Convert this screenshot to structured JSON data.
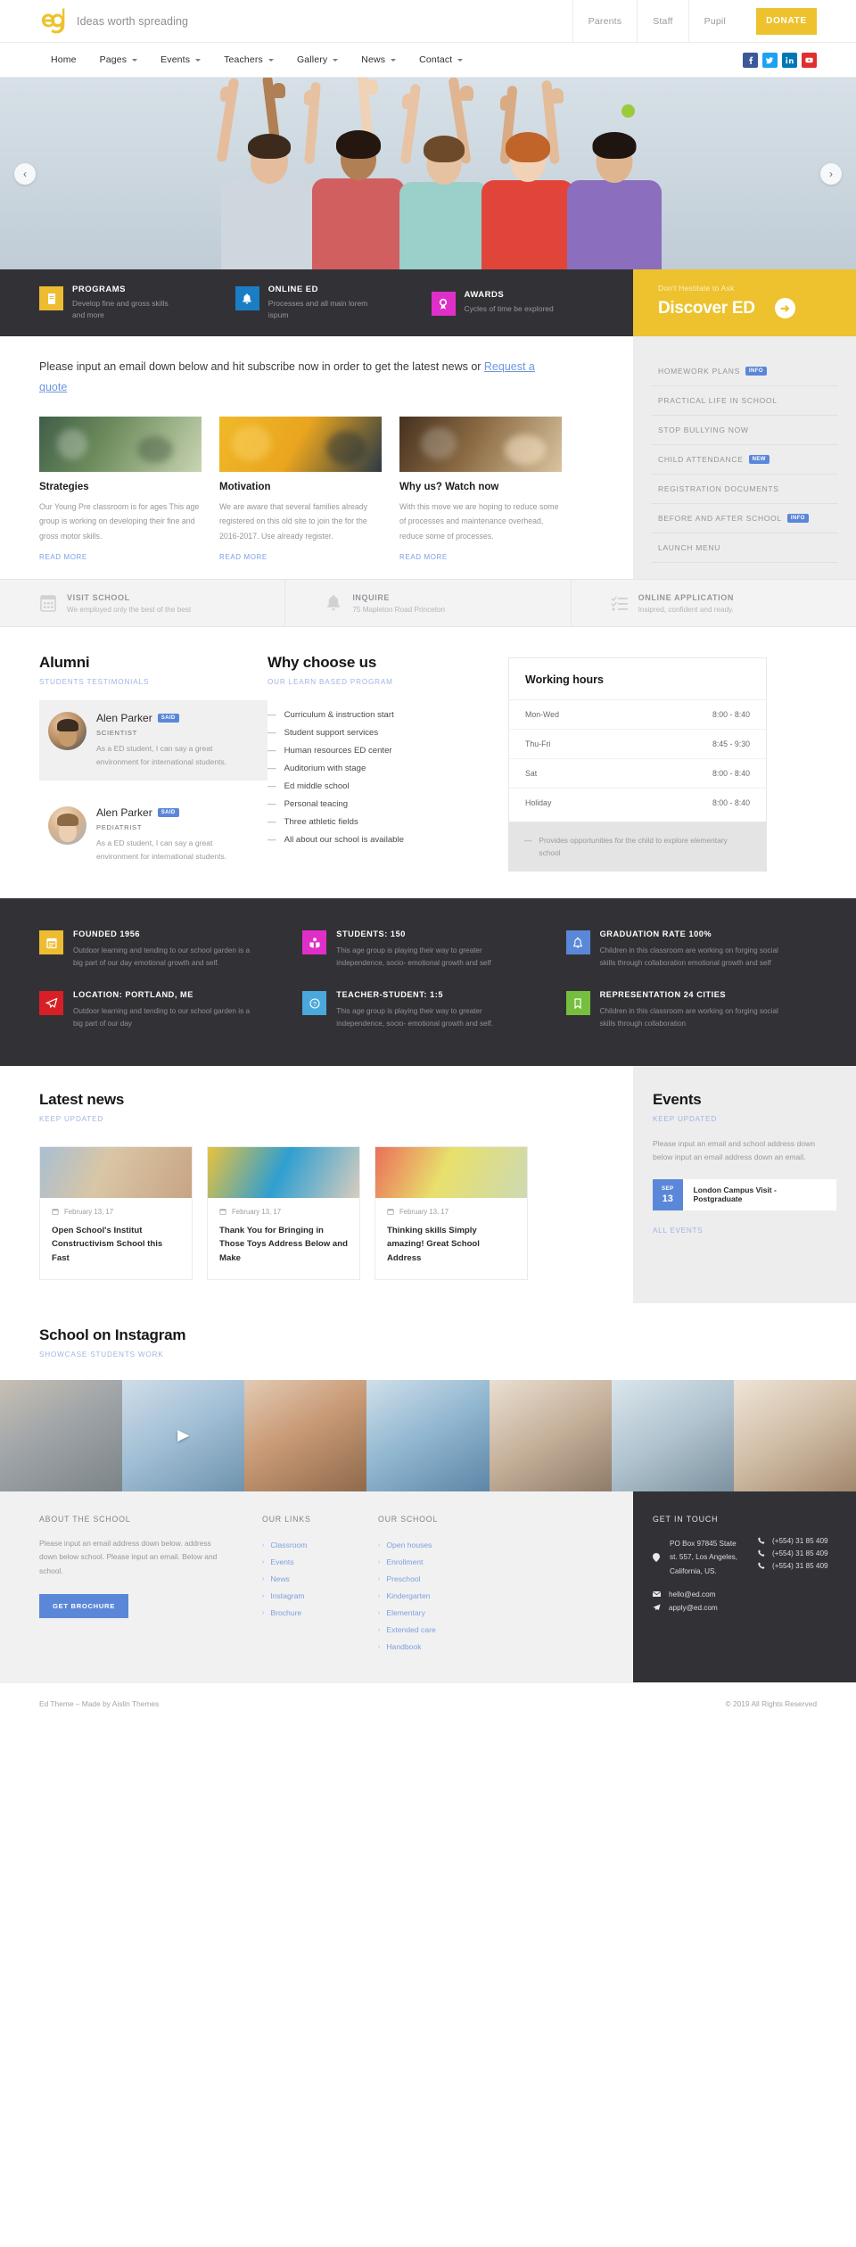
{
  "brand": {
    "logo_icon": "ed-logo-icon",
    "tagline": "Ideas worth spreading"
  },
  "topbar": {
    "links": [
      "Parents",
      "Staff",
      "Pupil"
    ],
    "donate_label": "DONATE",
    "donate_color": "#edc22e"
  },
  "nav": {
    "items": [
      {
        "label": "Home",
        "has_caret": false
      },
      {
        "label": "Pages",
        "has_caret": true
      },
      {
        "label": "Events",
        "has_caret": true
      },
      {
        "label": "Teachers",
        "has_caret": true
      },
      {
        "label": "Gallery",
        "has_caret": true
      },
      {
        "label": "News",
        "has_caret": true
      },
      {
        "label": "Contact",
        "has_caret": true
      }
    ],
    "social": [
      {
        "name": "facebook-icon",
        "color": "#3b5998"
      },
      {
        "name": "twitter-icon",
        "color": "#1da1f2"
      },
      {
        "name": "linkedin-icon",
        "color": "#0077b5"
      },
      {
        "name": "youtube-icon",
        "color": "#e02f2f"
      }
    ]
  },
  "hero": {
    "prev_icon": "chevron-left-icon",
    "next_icon": "chevron-right-icon",
    "alt": "Five children with raised hands and backpacks"
  },
  "features": [
    {
      "icon": "book-icon",
      "color": "#edbc31",
      "title": "PROGRAMS",
      "sub": "Develop fine and gross skills and more"
    },
    {
      "icon": "bell-icon",
      "color": "#1b7dc4",
      "title": "ONLINE ED",
      "sub": "Processes and all main lorem ispum"
    },
    {
      "icon": "award-icon",
      "color": "#e02fc8",
      "title": "AWARDS",
      "sub": "Cycles of time be explored"
    }
  ],
  "discover": {
    "eyebrow": "Don't Hestitate to Ask",
    "title": "Discover ED",
    "arrow_icon": "arrow-right-circle-icon",
    "bg": "#edc22e"
  },
  "subscribe": {
    "text_before": "Please input an email down below and hit subscribe now in order to get the latest news or ",
    "link_label": "Request a quote"
  },
  "promo_cards": [
    {
      "title": "Strategies",
      "body": "Our Young Pre classroom is for ages This age group is working on developing their fine and gross motor skills.",
      "readmore": "READ MORE"
    },
    {
      "title": "Motivation",
      "body": "We are aware that several families already registered on this old site to join the for the 2016-2017. Use already register.",
      "readmore": "READ MORE"
    },
    {
      "title": "Why us? Watch now",
      "body": "With this move we are hoping to reduce some of processes and maintenance overhead, reduce some of processes.",
      "readmore": "READ MORE"
    }
  ],
  "sidebar": {
    "items": [
      {
        "label": "HOMEWORK PLANS",
        "badge": "INFO"
      },
      {
        "label": "PRACTICAL LIFE IN SCHOOL",
        "badge": ""
      },
      {
        "label": "STOP BULLYING NOW",
        "badge": ""
      },
      {
        "label": "CHILD ATTENDANCE",
        "badge": "NEW"
      },
      {
        "label": "REGISTRATION DOCUMENTS",
        "badge": ""
      },
      {
        "label": "BEFORE AND AFTER SCHOOL",
        "badge": "INFO"
      },
      {
        "label": "LAUNCH MENU",
        "badge": ""
      }
    ],
    "badge_color": "#5b87d9"
  },
  "cta_strip": [
    {
      "icon": "calendar-icon",
      "title": "VISIT SCHOOL",
      "sub": "We employed only the best of the best"
    },
    {
      "icon": "bell-icon",
      "title": "INQUIRE",
      "sub": "75 Mapleton Road Princeton"
    },
    {
      "icon": "checklist-icon",
      "title": "ONLINE APPLICATION",
      "sub": "Insipred, confident and ready."
    }
  ],
  "alumni": {
    "title": "Alumni",
    "subtitle": "STUDENTS TESTIMONIALS",
    "testimonials": [
      {
        "name": "Alen Parker",
        "badge": "SAID",
        "role": "SCIENTIST",
        "quote": "As a ED student, I can say a great environment for international students."
      },
      {
        "name": "Alen Parker",
        "badge": "SAID",
        "role": "PEDIATRIST",
        "quote": "As a ED student, I can say a great environment for international students."
      }
    ]
  },
  "why": {
    "title": "Why choose us",
    "subtitle": "OUR LEARN BASED PROGRAM",
    "items": [
      "Curriculum & instruction start",
      "Student support services",
      "Human resources ED center",
      "Auditorium with stage",
      "Ed middle school",
      "Personal teacing",
      "Three athletic fields",
      "All about our school is available"
    ]
  },
  "working_hours": {
    "title": "Working hours",
    "rows": [
      {
        "day": "Mon-Wed",
        "time": "8:00 - 8:40"
      },
      {
        "day": "Thu-Fri",
        "time": "8:45 - 9:30"
      },
      {
        "day": "Sat",
        "time": "8:00 - 8:40"
      },
      {
        "day": "Holiday",
        "time": "8:00 - 8:40"
      }
    ],
    "note": "Provides opportunities for the child to explore elementary school"
  },
  "stats": [
    {
      "icon": "calendar-icon",
      "color": "#edbc31",
      "title": "FOUNDED 1956",
      "desc": "Outdoor learning and tending to our school garden is a big part of our day emotional growth and self."
    },
    {
      "icon": "book-open-icon",
      "color": "#e02fc8",
      "title": "STUDENTS: 150",
      "desc": "This age group is playing their way to greater independence, socio- emotional growth and self"
    },
    {
      "icon": "bell-icon",
      "color": "#5b87d9",
      "title": "GRADUATION RATE 100%",
      "desc": "Children in this classroom are working on forging social skills through collaboration emotional growth and self"
    },
    {
      "icon": "paper-plane-icon",
      "color": "#d81f26",
      "title": "LOCATION: PORTLAND, ME",
      "desc": "Outdoor learning and tending to our school garden is a big part of our day"
    },
    {
      "icon": "question-circle-icon",
      "color": "#4aa8dd",
      "title": "TEACHER-STUDENT: 1:5",
      "desc": "This age group is playing their way to greater independence, socio- emotional growth and self."
    },
    {
      "icon": "bookmark-icon",
      "color": "#76bf3e",
      "title": "REPRESENTATION 24 CITIES",
      "desc": "Children in this classroom are working on forging social skills through collaboration"
    }
  ],
  "latest_news": {
    "title": "Latest news",
    "subtitle": "KEEP UPDATED",
    "posts": [
      {
        "date": "February 13, 17",
        "title": "Open School's Institut Constructivism School this Fast",
        "date_icon": "calendar-icon"
      },
      {
        "date": "February 13, 17",
        "title": "Thank You for Bringing in Those Toys Address Below and Make",
        "date_icon": "calendar-icon"
      },
      {
        "date": "February 13, 17",
        "title": "Thinking skills Simply amazing! Great School Address",
        "date_icon": "calendar-icon"
      }
    ]
  },
  "events": {
    "title": "Events",
    "subtitle": "KEEP UPDATED",
    "description": "Please input an email and school address down below input an email address down an email.",
    "list": [
      {
        "month": "SEP",
        "day": "13",
        "name": "London Campus Visit - Postgraduate"
      }
    ],
    "all_label": "ALL EVENTS",
    "date_color": "#5b87d9"
  },
  "instagram": {
    "title": "School on Instagram",
    "subtitle": "SHOWCASE STUDENTS WORK",
    "tiles": 7,
    "play_icon": "play-icon"
  },
  "footer": {
    "about": {
      "heading": "ABOUT THE SCHOOL",
      "text": "Please input an email address down below. address down below school. Please input an email. Below and school.",
      "button": "GET BROCHURE",
      "button_color": "#5b87d9"
    },
    "our_links": {
      "heading": "OUR LINKS",
      "items": [
        "Classroom",
        "Events",
        "News",
        "Instagram",
        "Brochure"
      ]
    },
    "our_school": {
      "heading": "OUR SCHOOL",
      "items": [
        "Open houses",
        "Enrollment",
        "Preschool",
        "Kindergarten",
        "Elementary",
        "Extended care",
        "Handbook"
      ]
    },
    "get_in_touch": {
      "heading": "GET IN TOUCH",
      "address_icon": "map-pin-icon",
      "address": "PO Box 97845 State st. 557, Los Angeles, California, US.",
      "phone_icon": "phone-icon",
      "phones": [
        "(+554) 31 85 409",
        "(+554) 31 85 409",
        "(+554) 31 85 409"
      ],
      "emails": [
        {
          "icon": "mail-icon",
          "value": "hello@ed.com"
        },
        {
          "icon": "paper-plane-icon",
          "value": "apply@ed.com"
        }
      ]
    }
  },
  "copyright": {
    "left": "Ed Theme – Made by Aislin Themes",
    "right": "© 2019 All Rights Reserved"
  }
}
